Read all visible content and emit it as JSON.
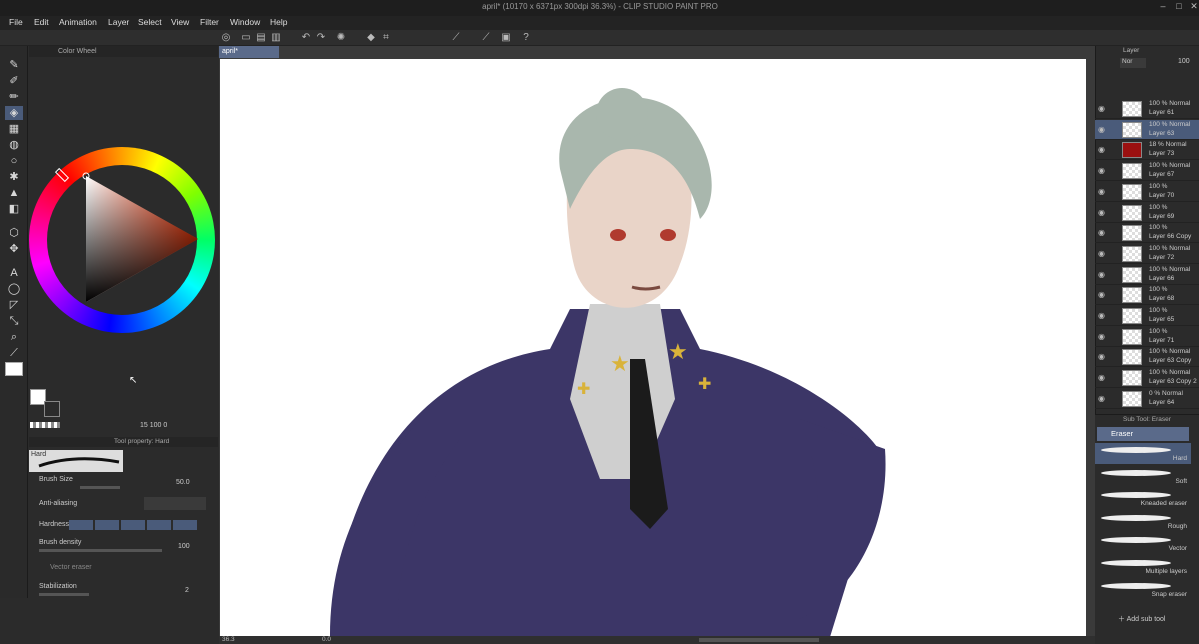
{
  "titlebar": {
    "title": "april* (10170 x 6371px 300dpi 36.3%)  - CLIP STUDIO PAINT PRO"
  },
  "menu": [
    "File",
    "Edit",
    "Animation",
    "Layer",
    "Select",
    "View",
    "Filter",
    "Window",
    "Help"
  ],
  "color_wheel": {
    "title": "Color Wheel",
    "readout": "15   100   0"
  },
  "tool_property": {
    "title": "Tool property: Hard",
    "brush_name": "Hard",
    "brush_size_label": "Brush Size",
    "brush_size": "50.0",
    "anti_alias_label": "Anti-aliasing",
    "hardness_label": "Hardness",
    "density_label": "Brush density",
    "density": "100",
    "vector_eraser_label": "Vector eraser",
    "stabilization_label": "Stabilization",
    "stabilization": "2"
  },
  "document": {
    "tab": "april*",
    "zoom": "36.3",
    "angle": "0.0"
  },
  "layer_panel": {
    "title": "Layer",
    "blend": "Nor",
    "opacity": "100",
    "layers": [
      {
        "mode": "100 % Normal",
        "name": "Layer 61"
      },
      {
        "mode": "100 % Normal",
        "name": "Layer 63"
      },
      {
        "mode": "18 % Normal",
        "name": "Layer 73"
      },
      {
        "mode": "100 % Normal",
        "name": "Layer 67"
      },
      {
        "mode": "100 %",
        "name": "Layer 70"
      },
      {
        "mode": "100 %",
        "name": "Layer 69"
      },
      {
        "mode": "100 %",
        "name": "Layer 66 Copy"
      },
      {
        "mode": "100 % Normal",
        "name": "Layer 72"
      },
      {
        "mode": "100 % Normal",
        "name": "Layer 66"
      },
      {
        "mode": "100 %",
        "name": "Layer 68"
      },
      {
        "mode": "100 %",
        "name": "Layer 65"
      },
      {
        "mode": "100 %",
        "name": "Layer 71"
      },
      {
        "mode": "100 % Normal",
        "name": "Layer 63 Copy"
      },
      {
        "mode": "100 % Normal",
        "name": "Layer 63 Copy 2"
      },
      {
        "mode": "0 % Normal",
        "name": "Layer 64"
      }
    ]
  },
  "subtool": {
    "title": "Sub Tool: Eraser",
    "group": "Eraser",
    "brushes": [
      "Hard",
      "Soft",
      "Kneaded eraser",
      "Rough",
      "Vector",
      "Multiple layers",
      "Snap eraser"
    ],
    "add_label": "Add sub tool"
  }
}
